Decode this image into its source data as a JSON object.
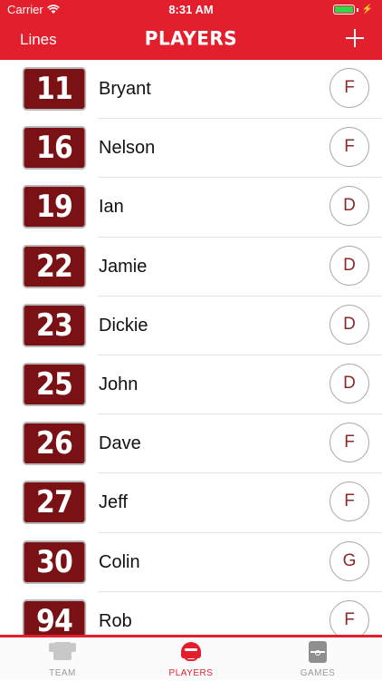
{
  "status_bar": {
    "carrier": "Carrier",
    "time": "8:31 AM"
  },
  "nav": {
    "left_label": "Lines",
    "title": "PLAYERS"
  },
  "players": [
    {
      "number": "11",
      "name": "Bryant",
      "position": "F"
    },
    {
      "number": "16",
      "name": "Nelson",
      "position": "F"
    },
    {
      "number": "19",
      "name": "Ian",
      "position": "D"
    },
    {
      "number": "22",
      "name": "Jamie",
      "position": "D"
    },
    {
      "number": "23",
      "name": "Dickie",
      "position": "D"
    },
    {
      "number": "25",
      "name": "John",
      "position": "D"
    },
    {
      "number": "26",
      "name": "Dave",
      "position": "F"
    },
    {
      "number": "27",
      "name": "Jeff",
      "position": "F"
    },
    {
      "number": "30",
      "name": "Colin",
      "position": "G"
    },
    {
      "number": "94",
      "name": "Rob",
      "position": "F"
    }
  ],
  "tabs": [
    {
      "label": "TEAM",
      "icon": "jersey-icon",
      "active": false
    },
    {
      "label": "PLAYERS",
      "icon": "helmet-icon",
      "active": true
    },
    {
      "label": "GAMES",
      "icon": "rink-icon",
      "active": false
    }
  ],
  "colors": {
    "brand_red": "#e31f2d",
    "badge_maroon": "#7a1215",
    "position_text": "#8b2a2a",
    "battery_green": "#35d54a"
  }
}
